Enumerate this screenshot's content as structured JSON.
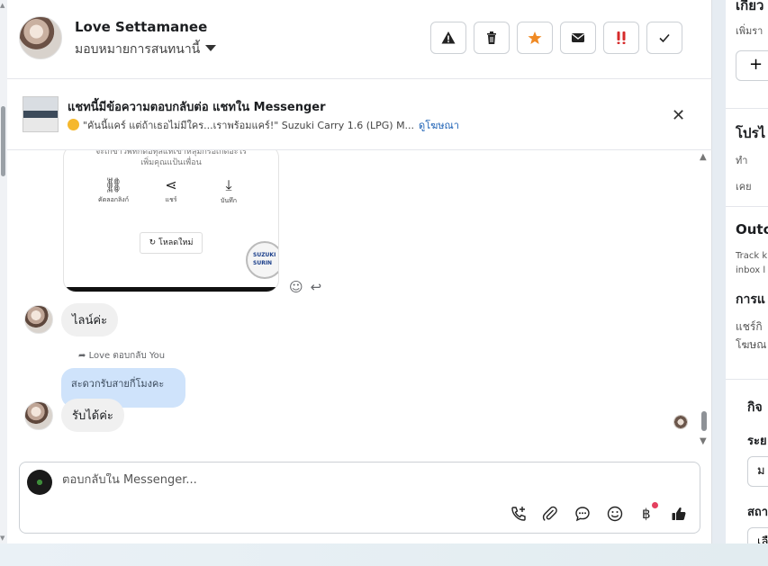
{
  "header": {
    "contact_name": "Love Settamanee",
    "assign_label": "มอบหมายการสนทนานี้",
    "toolbar": [
      "alert-icon",
      "trash-icon",
      "star-icon",
      "envelope-icon",
      "double-exclamation-icon",
      "checkmark-icon"
    ]
  },
  "banner": {
    "title": "แชทนี้มีข้อความตอบกลับต่อ แชทใน Messenger",
    "subtitle": "\"คันนี้แคร์ แต่ถ้าเธอไม่มีใคร...เราพร้อมแคร์!\" Suzuki Carry 1.6 (LPG) M...",
    "link": "ดูโฆษณา"
  },
  "shared_image": {
    "top_text_1": "จะเกขาวพทกดอทุลแทเข้าหลุมกร้อเกิดอะไร",
    "top_text_2": "เพิ่มคุณแป้นเพื่อน",
    "icon_labels": [
      "คัดลอกลิงก์",
      "แชร์",
      "บันทึก"
    ],
    "reload_label": "โหลดใหม่",
    "logo_text_1": "SUZUKI",
    "logo_text_2": "SURIN"
  },
  "messages": [
    {
      "text": "ไลน์ค่ะ"
    },
    {
      "replied_label": "Love ตอบกลับ You",
      "quoted": "สะดวกรับสายกี่โมงคะ",
      "text": "รับได้ค่ะ"
    }
  ],
  "composer": {
    "placeholder": "ตอบกลับใน Messenger..."
  },
  "right_panel": {
    "t1": "เกี่ยว",
    "t2": "เพิ่มรา",
    "plus": "+",
    "t3": "โปรไ",
    "t4": "ทำ",
    "t5": "เคย",
    "t6": "Outc",
    "t7": "Track k",
    "t8": "inbox l",
    "t9": "การแ",
    "t10": "แชร์กิ",
    "t11": "โฆษณ",
    "t12": "กิจ",
    "t13": "ระย",
    "t14": "ม",
    "t15": "สถา",
    "t16": "เลื"
  }
}
